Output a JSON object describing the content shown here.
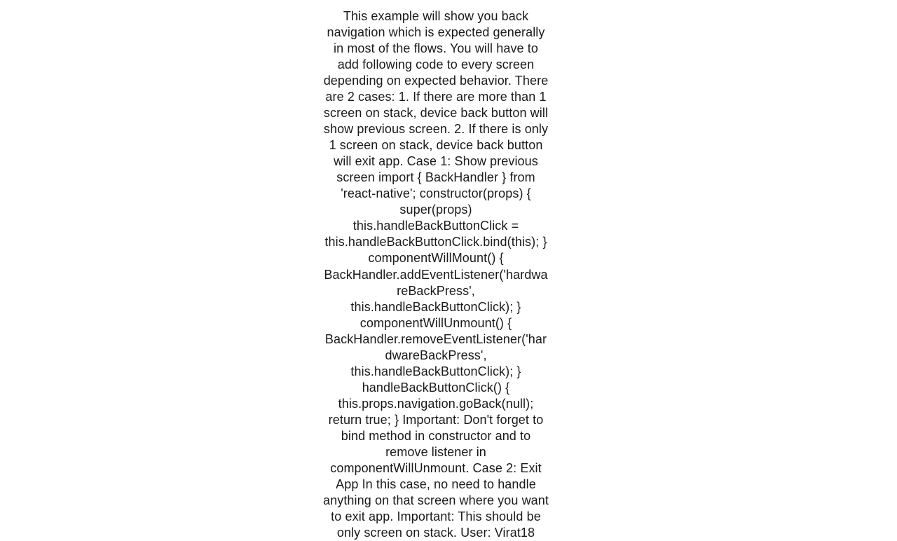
{
  "document": {
    "body": "This example will show you back navigation which is expected generally in most of the flows. You will have to add following code to every screen depending on expected behavior. There are 2 cases:  1. If there are more than 1 screen on stack, device back button will show previous screen.   2. If there is only 1 screen on stack, device back button will exit app. Case 1: Show previous screen import { BackHandler } from 'react-native';  constructor(props) {     super(props)     this.handleBackButtonClick = this.handleBackButtonClick.bind(this); }  componentWillMount() {     BackHandler.addEventListener('hardwareBackPress', this.handleBackButtonClick); }  componentWillUnmount() {     BackHandler.removeEventListener('hardwareBackPress', this.handleBackButtonClick); }  handleBackButtonClick() {     this.props.navigation.goBack(null);     return true; }  Important: Don't forget to bind method in constructor and to remove listener in componentWillUnmount. Case 2: Exit App In this case, no need to handle anything on that screen where you want to exit app. Important: This should be only screen on stack.  User: Virat18"
  }
}
